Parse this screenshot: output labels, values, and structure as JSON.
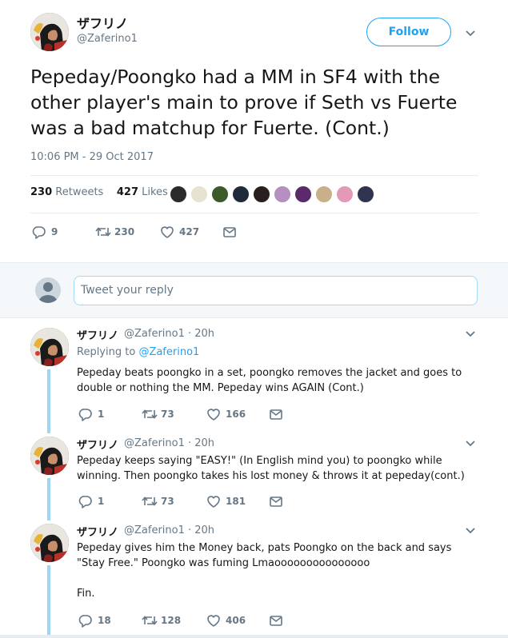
{
  "main_tweet": {
    "display_name": "ザフリノ",
    "handle": "@Zaferino1",
    "follow_label": "Follow",
    "text": "Pepeday/Poongko had a MM in SF4 with the other player's main to prove if Seth vs Fuerte was a bad matchup for Fuerte. (Cont.)",
    "timestamp": "10:06 PM - 29 Oct 2017",
    "retweets_count": "230",
    "retweets_label": "Retweets",
    "likes_count": "427",
    "likes_label": "Likes",
    "actions": {
      "replies": "9",
      "retweets": "230",
      "likes": "427"
    },
    "icons": [
      "reply-icon",
      "retweet-icon",
      "like-icon",
      "dm-icon"
    ],
    "liker_colors": [
      "#2b2b2b",
      "#e8e2d0",
      "#3c5a2a",
      "#1f2a3a",
      "#2a1f1f",
      "#b48fbf",
      "#5a2a6a",
      "#c9b08a",
      "#e29ab8",
      "#2f3550"
    ]
  },
  "reply_box": {
    "placeholder": "Tweet your reply"
  },
  "replies": [
    {
      "display_name": "ザフリノ",
      "meta": "@Zaferino1 · 20h",
      "replying_prefix": "Replying to ",
      "replying_handle": "@Zaferino1",
      "text": "Pepeday beats poongko in a set, poongko removes the jacket and goes to double or nothing the MM. Pepeday wins AGAIN (Cont.)",
      "replies": "1",
      "retweets": "73",
      "likes": "166"
    },
    {
      "display_name": "ザフリノ",
      "meta": "@Zaferino1 · 20h",
      "text": "Pepeday keeps saying \"EASY!\" (In English mind you) to poongko while winning. Then poongko takes his lost money & throws it at pepeday(cont.)",
      "replies": "1",
      "retweets": "73",
      "likes": "181"
    },
    {
      "display_name": "ザフリノ",
      "meta": "@Zaferino1 · 20h",
      "text": "Pepeday gives him the Money back, pats Poongko on the back and says \"Stay Free.\" Poongko was fuming Lmaooooooooooooooo\n\nFin.",
      "replies": "18",
      "retweets": "128",
      "likes": "406"
    }
  ],
  "colors": {
    "accent": "#1da1f2",
    "muted": "#657786",
    "thread_line": "#9fd6f3",
    "border": "#e6ecf0"
  }
}
